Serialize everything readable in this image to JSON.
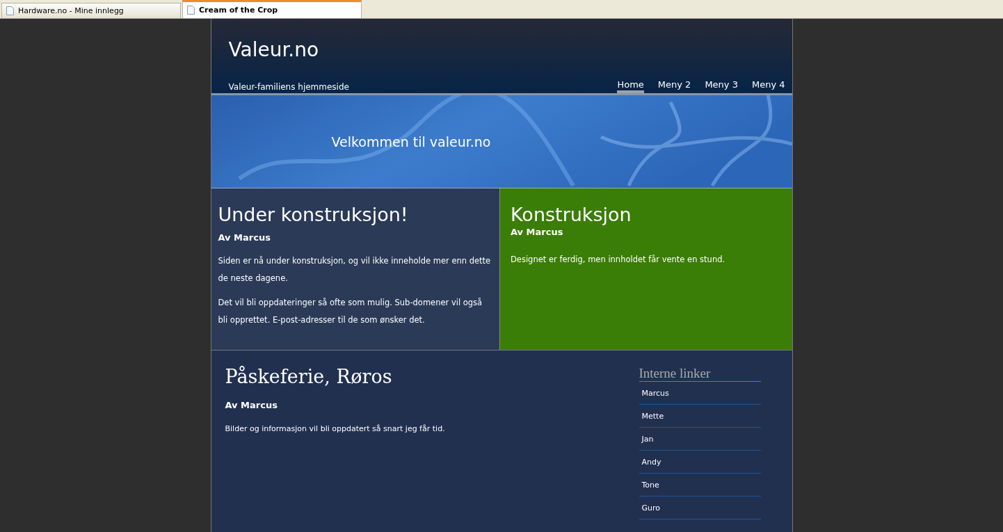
{
  "browser_tabs": [
    {
      "label": "Hardware.no - Mine innlegg",
      "selected": false
    },
    {
      "label": "Cream of the Crop",
      "selected": true
    }
  ],
  "header": {
    "site_title": "Valeur.no",
    "tagline": "Valeur-familiens hjemmeside",
    "nav": [
      {
        "label": "Home",
        "selected": true
      },
      {
        "label": "Meny 2",
        "selected": false
      },
      {
        "label": "Meny 3",
        "selected": false
      },
      {
        "label": "Meny 4",
        "selected": false
      }
    ]
  },
  "banner": {
    "text": "Velkommen til valeur.no"
  },
  "cards": [
    {
      "title": "Under konstruksjon!",
      "author": "Av Marcus",
      "color": "#2a3a57",
      "paragraphs": [
        "Siden er nå under konstruksjon, og vil ikke inneholde mer enn dette de neste dagene.",
        "Det vil bli oppdateringer så ofte som mulig. Sub-domener vil også bli opprettet. E-post-adresser til de som ønsker det."
      ]
    },
    {
      "title": "Konstruksjon",
      "author": "Av Marcus",
      "color": "#3a7d07",
      "paragraphs": [
        "Designet er ferdig, men innholdet får vente en stund."
      ]
    }
  ],
  "post": {
    "title": "Påskeferie, Røros",
    "author": "Av Marcus",
    "text": "Bilder og informasjon vil bli oppdatert så snart jeg får tid."
  },
  "sidebar": {
    "title": "Interne linker",
    "links": [
      "Marcus",
      "Mette",
      "Jan",
      "Andy",
      "Tone",
      "Guro"
    ]
  }
}
